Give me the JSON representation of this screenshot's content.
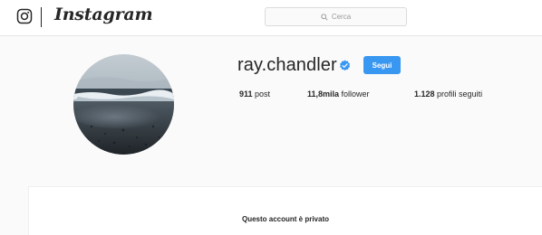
{
  "nav": {
    "logo_icon": "instagram-glyph-icon",
    "wordmark": "Instagram",
    "search": {
      "icon": "search-icon",
      "placeholder": "Cerca"
    }
  },
  "profile": {
    "username": "ray.chandler",
    "verified_icon": "verified-badge-icon",
    "follow_label": "Segui",
    "stats": {
      "posts_value": "911",
      "posts_label": "post",
      "followers_value": "11,8mila",
      "followers_label": "follower",
      "following_value": "1.128",
      "following_label": "profili seguiti"
    }
  },
  "private_notice": "Questo account è privato",
  "colors": {
    "accent": "#3897f0",
    "text": "#262626",
    "background": "#fafafa",
    "panel": "#ffffff"
  }
}
